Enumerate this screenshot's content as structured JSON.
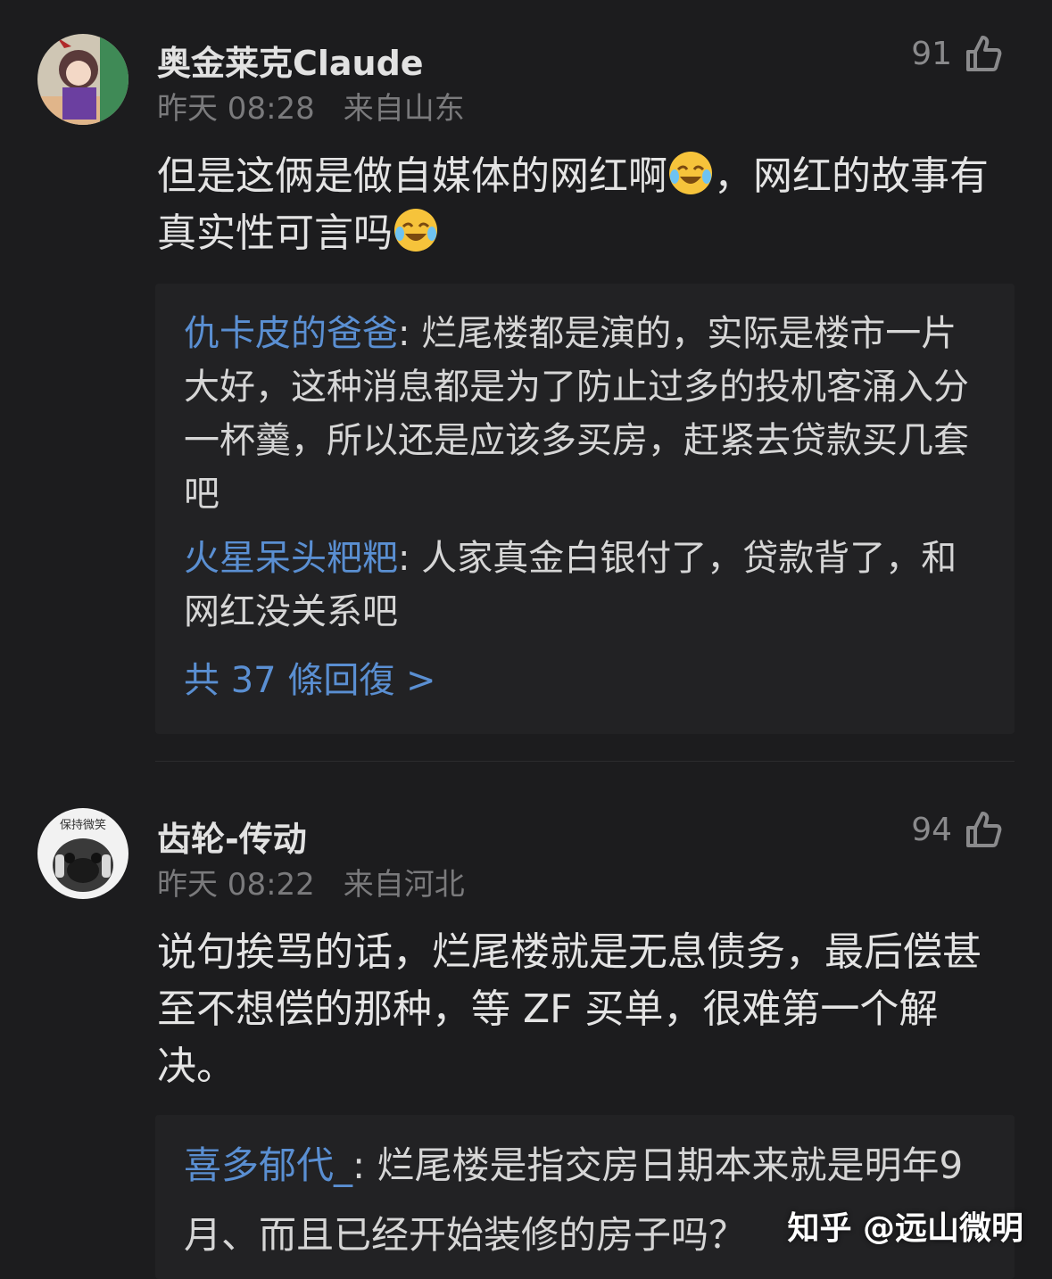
{
  "comments": [
    {
      "author": "奥金莱克Claude",
      "time": "昨天 08:28",
      "location": "来自山东",
      "likes": "91",
      "text_a": "但是这俩是做自媒体的网红啊",
      "text_b": "，网红的故事有真实性可言吗",
      "replies": [
        {
          "name": "仇卡皮的爸爸",
          "text": ": 烂尾楼都是演的，实际是楼市一片大好，这种消息都是为了防止过多的投机客涌入分一杯羹，所以还是应该多买房，赶紧去贷款买几套吧"
        },
        {
          "name": "火星呆头粑粑",
          "text": ": 人家真金白银付了，贷款背了，和网红没关系吧"
        }
      ],
      "more": "共 37 條回復 >"
    },
    {
      "author": "齿轮-传动",
      "time": "昨天 08:22",
      "location": "来自河北",
      "likes": "94",
      "text": "说句挨骂的话，烂尾楼就是无息债务，最后偿甚至不想偿的那种，等 ZF 买单，很难第一个解决。",
      "avatar_text": "保持微笑",
      "replies": [
        {
          "name": "喜多郁代_",
          "text": ": 烂尾楼是指交房日期本来就是明年9月、而且已经开始装修的房子吗？"
        }
      ]
    }
  ],
  "watermark": "知乎 @远山微明",
  "colors": {
    "background": "#1c1c1e",
    "reply_box": "#222224",
    "link": "#5a8fd2"
  }
}
